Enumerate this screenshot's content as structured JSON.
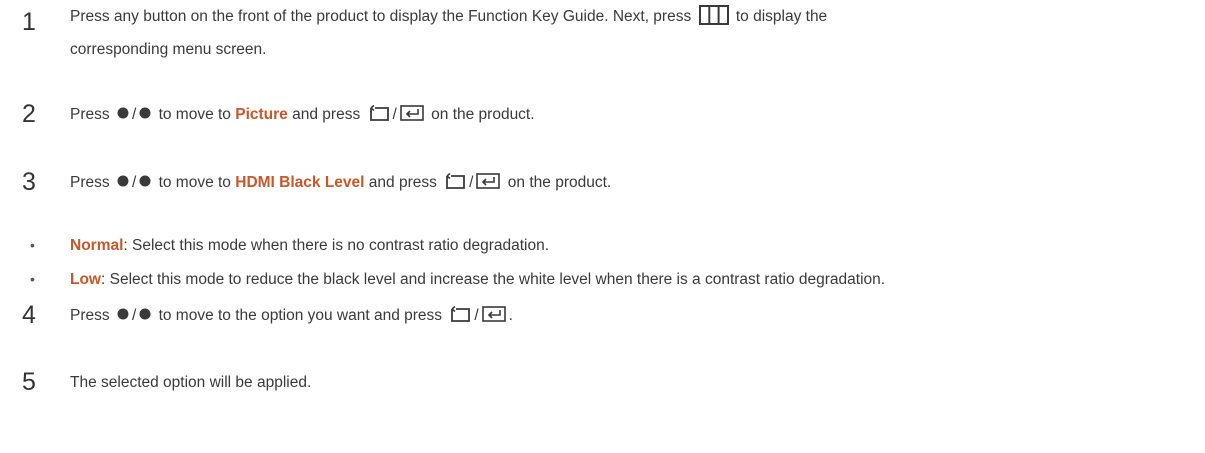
{
  "steps": [
    {
      "num": "1",
      "line1_a": "Press any button on the front of the product to display the Function Key Guide. Next, press",
      "line1_b": "to display the",
      "line2": "corresponding menu screen."
    },
    {
      "num": "2",
      "a": "Press",
      "sep": "/",
      "b": "to move to",
      "hl": "Picture",
      "c": "and press",
      "d": "on the product."
    },
    {
      "num": "3",
      "a": "Press",
      "sep": "/",
      "b": "to move to",
      "hl": "HDMI Black Level",
      "c": "and press",
      "d": "on the product."
    },
    {
      "num": "4",
      "a": "Press",
      "sep": "/",
      "b": "to move to the option you want and press",
      "d": "."
    },
    {
      "num": "5",
      "a": "The selected option will be applied."
    }
  ],
  "bullets": [
    {
      "marker": "•",
      "term": "Normal",
      "desc": ": Select this mode when there is no contrast ratio degradation."
    },
    {
      "marker": "•",
      "term": "Low",
      "desc": ": Select this mode to reduce the black level and increase the white level when there is a contrast ratio degradation."
    }
  ],
  "colors": {
    "highlight": "#c8572a",
    "text": "#3a3a3a"
  },
  "icons": [
    "menu-grid-icon",
    "nav-dot-icon",
    "return-icon",
    "enter-icon"
  ]
}
